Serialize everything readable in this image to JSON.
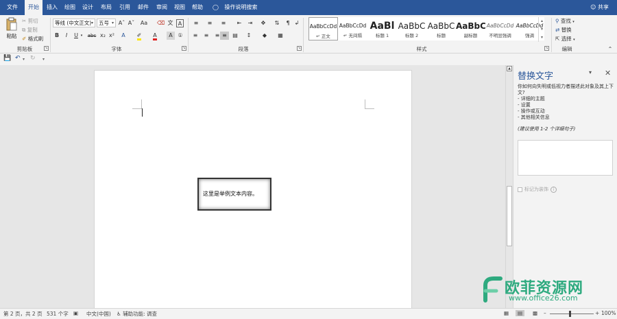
{
  "tabs": [
    {
      "label": "文件"
    },
    {
      "label": "开始",
      "active": true
    },
    {
      "label": "插入"
    },
    {
      "label": "绘图"
    },
    {
      "label": "设计"
    },
    {
      "label": "布局"
    },
    {
      "label": "引用"
    },
    {
      "label": "邮件"
    },
    {
      "label": "审阅"
    },
    {
      "label": "视图"
    },
    {
      "label": "帮助"
    }
  ],
  "tell_me": "操作说明搜索",
  "share": "共享",
  "ribbon": {
    "clipboard": {
      "paste": "粘贴",
      "cut": "剪切",
      "copy": "复制",
      "format_painter": "格式刷",
      "label": "剪贴板"
    },
    "font": {
      "font_name": "等线 (中文正文)",
      "font_size": "五号",
      "label": "字体",
      "bold": "B",
      "italic": "I",
      "underline": "U",
      "strike": "abc",
      "sub": "x₂",
      "sup": "x²",
      "case": "Aa"
    },
    "paragraph": {
      "label": "段落"
    },
    "styles": {
      "label": "样式",
      "items": [
        {
          "sample": "AaBbCcDd",
          "name": "正文",
          "selected": true
        },
        {
          "sample": "AaBbCcDd",
          "name": "无间隔"
        },
        {
          "sample": "AaBl",
          "name": "标题 1"
        },
        {
          "sample": "AaBbC",
          "name": "标题 2"
        },
        {
          "sample": "AaBbC",
          "name": "标题"
        },
        {
          "sample": "AaBbC",
          "name": "副标题"
        },
        {
          "sample": "AaBbCcDd",
          "name": "不明显强调"
        },
        {
          "sample": "AaBbCcDd",
          "name": "强调"
        }
      ]
    },
    "editing": {
      "find": "查找",
      "replace": "替换",
      "select": "选择",
      "label": "编辑"
    }
  },
  "document": {
    "textbox_text": "这里是举例文本内容。"
  },
  "alt_text_pane": {
    "title": "替换文字",
    "description_lines": [
      "你如何向失明或低视力者描述此对象及其上下文?",
      "- 详细的主题",
      "- 设置",
      "- 操作或互动",
      "- 其他相关信息"
    ],
    "hint": "(建议使用 1-2 个详细句子)",
    "decorative_label": "标记为装饰"
  },
  "status": {
    "page": "第 2 页，共 2 页",
    "words": "531 个字",
    "language": "中文(中国)",
    "accessibility": "辅助功能: 调查",
    "zoom": "100%"
  },
  "watermark": {
    "name": "欧菲资源网",
    "url": "www.office26.com"
  },
  "colors": {
    "accent": "#2b579a",
    "watermark": "#2eaa7f"
  }
}
